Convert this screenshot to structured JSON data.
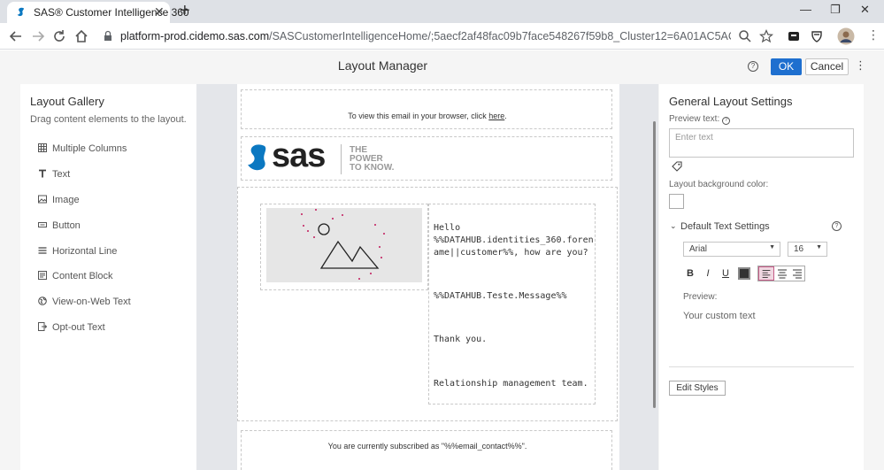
{
  "browser": {
    "tab_title": "SAS® Customer Intelligence 360",
    "tab_close": "✕",
    "new_tab": "+",
    "url_host": "platform-prod.cidemo.sas.com",
    "url_path": "/SASCustomerIntelligenceHome/;5aecf2af48fac09b7face548267f59b8_Cluster12=6A01AC5AC011ED6D57C04D...",
    "minimize": "—",
    "restore": "❐",
    "close": "✕"
  },
  "header": {
    "title": "Layout Manager",
    "help": "?",
    "ok": "OK",
    "cancel": "Cancel",
    "more": "⋮"
  },
  "gallery": {
    "title": "Layout Gallery",
    "subtitle": "Drag content elements to the layout.",
    "items": [
      {
        "label": "Multiple Columns",
        "icon": "columns-icon"
      },
      {
        "label": "Text",
        "icon": "text-icon"
      },
      {
        "label": "Image",
        "icon": "image-icon"
      },
      {
        "label": "Button",
        "icon": "button-icon"
      },
      {
        "label": "Horizontal Line",
        "icon": "horizontal-line-icon"
      },
      {
        "label": "Content Block",
        "icon": "content-block-icon"
      },
      {
        "label": "View-on-Web Text",
        "icon": "globe-icon"
      },
      {
        "label": "Opt-out Text",
        "icon": "opt-out-icon"
      }
    ]
  },
  "email": {
    "view_text": "To view this email in your browser, click",
    "view_link": "here",
    "view_end": ".",
    "logo_brand": "sas",
    "logo_tagline_1": "THE",
    "logo_tagline_2": "POWER",
    "logo_tagline_3": "TO KNOW.",
    "greeting_1": "Hello",
    "greeting_2": "%%DATAHUB.identities_360.foren",
    "greeting_3": "ame||customer%%, how are you?",
    "message": "%%DATAHUB.Teste.Message%%",
    "thanks": "Thank you.",
    "signature": "Relationship management team.",
    "subscribed": "You are currently subscribed as \"%%email_contact%%\"."
  },
  "settings": {
    "title": "General Layout Settings",
    "preview_text_label": "Preview text:",
    "preview_placeholder": "Enter text",
    "bg_color_label": "Layout background color:",
    "default_text_settings": "Default Text Settings",
    "font_family": "Arial",
    "font_size": "16",
    "bold": "B",
    "italic": "I",
    "underline": "U",
    "preview_label": "Preview:",
    "preview_sample": "Your custom text",
    "edit_styles": "Edit Styles"
  },
  "colors": {
    "accent": "#1e6fcf",
    "active_align": "#c45c86",
    "brand_blue": "#0b78c1"
  }
}
